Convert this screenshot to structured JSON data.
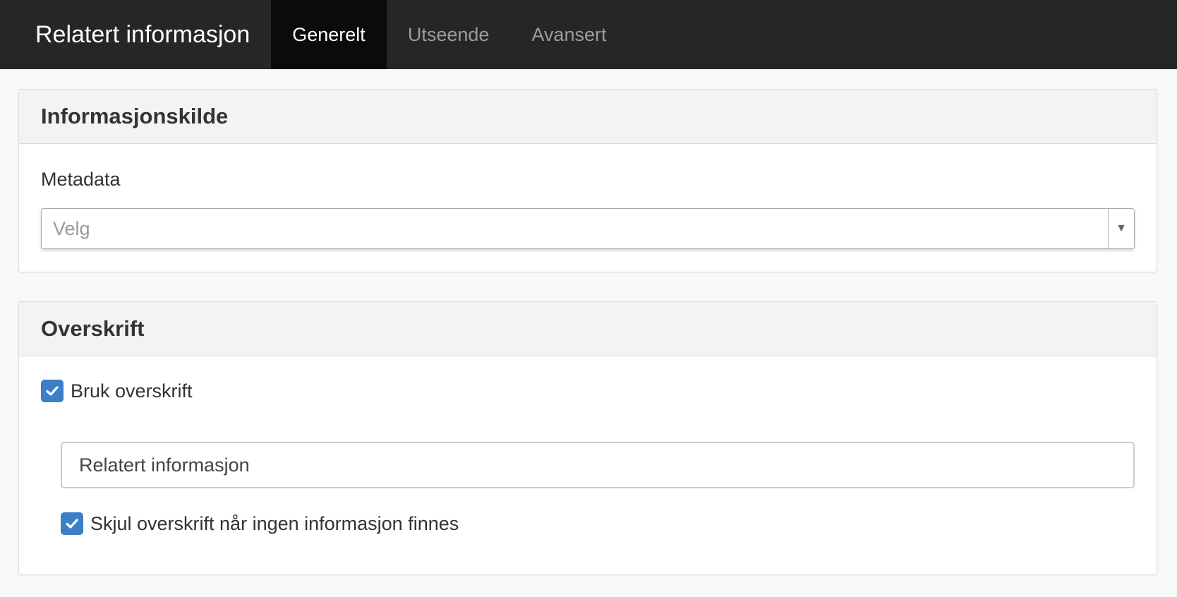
{
  "header": {
    "title": "Relatert informasjon",
    "tabs": [
      {
        "label": "Generelt",
        "active": true
      },
      {
        "label": "Utseende",
        "active": false
      },
      {
        "label": "Avansert",
        "active": false
      }
    ]
  },
  "source_panel": {
    "heading": "Informasjonskilde",
    "metadata_label": "Metadata",
    "metadata_placeholder": "Velg",
    "dropdown_icon": "caret-down-icon"
  },
  "heading_panel": {
    "heading": "Overskrift",
    "use_heading_label": "Bruk overskrift",
    "use_heading_checked": true,
    "heading_text_value": "Relatert informasjon",
    "hide_heading_label": "Skjul overskrift når ingen informasjon finnes",
    "hide_heading_checked": true,
    "check_icon": "checkmark-icon"
  },
  "colors": {
    "topbar": "#262626",
    "active_tab": "#0b0b0b",
    "checkbox": "#3d7fc6"
  }
}
